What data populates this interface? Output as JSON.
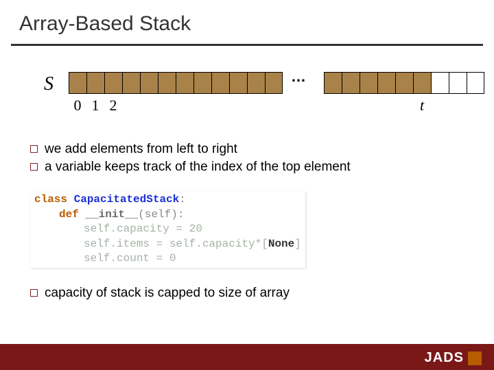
{
  "title": "Array-Based Stack",
  "diagram": {
    "array_label": "S",
    "ellipsis": "…",
    "indices": {
      "i0": "0",
      "i1": "1",
      "i2": "2",
      "it": "t"
    }
  },
  "bullets_a": {
    "b1": "we add elements from left to right",
    "b2": "a variable keeps track of the  index of the top element"
  },
  "code": {
    "kw_class": "class",
    "class_name": "CapacitatedStack",
    "colon": ":",
    "kw_def": "def",
    "init_name": "__init__",
    "init_args": "(self):",
    "line1": "self.capacity = 20",
    "line2a": "self.items = self.capacity*[",
    "none": "None",
    "line2b": "]",
    "line3": "self.count = 0"
  },
  "bullets_b": {
    "b1": "capacity of stack is capped to size of array"
  },
  "footer": {
    "logo_text": "JADS"
  }
}
